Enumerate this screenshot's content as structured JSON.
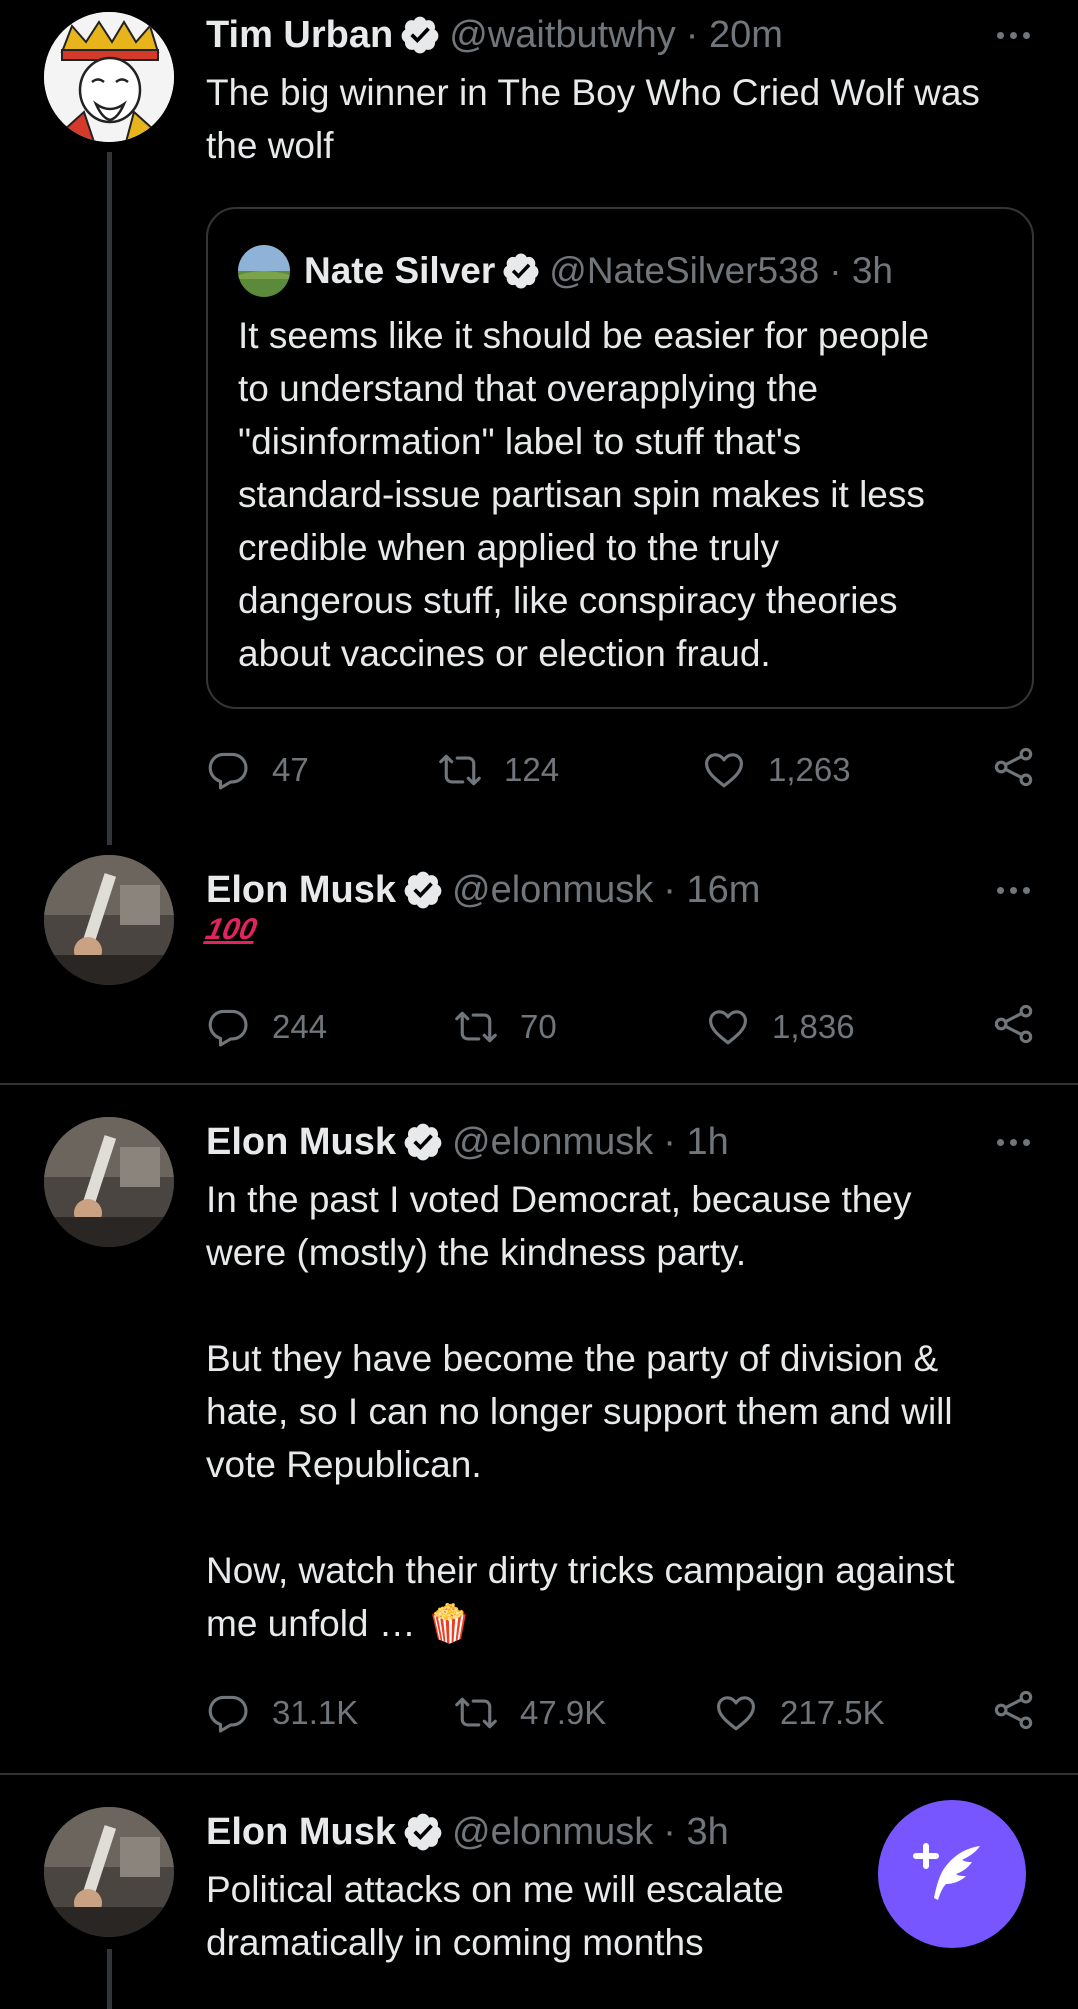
{
  "colors": {
    "background": "#000000",
    "muted": "#71767b",
    "fab": "#7856ff",
    "verified": "#e7e9ea"
  },
  "tweets": [
    {
      "name": "Tim Urban",
      "handle": "@waitbutwhy",
      "time": "· 20m",
      "text": "The big winner in The Boy Who Cried Wolf was\nthe wolf",
      "quote": {
        "name": "Nate Silver",
        "handle": "@NateSilver538",
        "time": "· 3h",
        "text": "It seems like it should be easier for people\nto understand that overapplying the\n\"disinformation\" label to stuff that's\nstandard-issue partisan spin makes it less\ncredible when applied to the truly\ndangerous stuff, like conspiracy theories\nabout vaccines or election fraud."
      },
      "replies": "47",
      "retweets": "124",
      "likes": "1,263"
    },
    {
      "name": "Elon Musk",
      "handle": "@elonmusk",
      "time": "· 16m",
      "emoji": "100",
      "replies": "244",
      "retweets": "70",
      "likes": "1,836"
    },
    {
      "name": "Elon Musk",
      "handle": "@elonmusk",
      "time": "· 1h",
      "text": "In the past I voted Democrat, because they\nwere (mostly) the kindness party.\n\nBut they have become the party of division &\nhate, so I can no longer support them and will\nvote Republican.\n\nNow, watch their dirty tricks campaign against\nme unfold … 🍿",
      "replies": "31.1K",
      "retweets": "47.9K",
      "likes": "217.5K"
    },
    {
      "name": "Elon Musk",
      "handle": "@elonmusk",
      "time": "· 3h",
      "text": "Political attacks on me will escalate\ndramatically in coming months"
    }
  ],
  "icons": {
    "reply": "reply-icon",
    "retweet": "retweet-icon",
    "like": "heart-icon",
    "share": "share-icon",
    "compose": "compose-tweet-icon"
  }
}
